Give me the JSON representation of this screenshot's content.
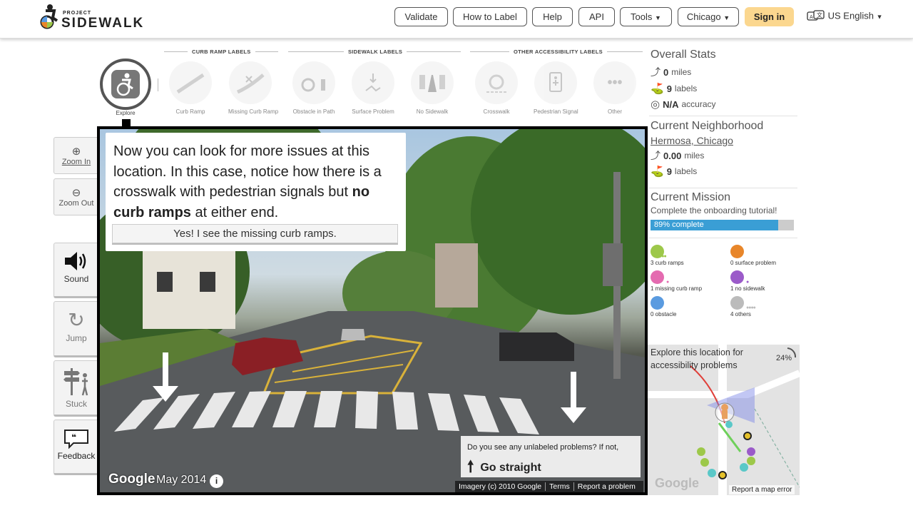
{
  "nav": {
    "logo_small": "PROJECT",
    "logo_big": "SIDEWALK",
    "buttons": [
      "Validate",
      "How to Label",
      "Help",
      "API",
      "Tools",
      "Chicago"
    ],
    "signin": "Sign in",
    "language": "US English"
  },
  "toolbar": {
    "groups": [
      "CURB RAMP LABELS",
      "SIDEWALK LABELS",
      "OTHER ACCESSIBILITY LABELS"
    ],
    "explore": "Explore",
    "labels": [
      "Curb Ramp",
      "Missing Curb Ramp",
      "Obstacle in Path",
      "Surface Problem",
      "No Sidewalk",
      "Crosswalk",
      "Pedestrian Signal",
      "Other"
    ]
  },
  "tools": {
    "zoom_in": "Zoom In",
    "zoom_out": "Zoom Out",
    "sound": "Sound",
    "jump": "Jump",
    "stuck": "Stuck",
    "feedback": "Feedback"
  },
  "tip": {
    "text_part1": "Now you can look for more issues at this location. In this case, notice how there is a crosswalk with pedestrian signals but ",
    "text_bold": "no curb ramps",
    "text_part2": " at either end.",
    "button": "Yes! I see the missing curb ramps."
  },
  "pano": {
    "question": "Do you see any unlabeled problems? If not,",
    "action": "Go straight",
    "google": "Google",
    "date": "May 2014",
    "info": "i",
    "footer": [
      "Imagery (c) 2010 Google",
      "Terms",
      "Report a problem"
    ]
  },
  "stats": {
    "overall_title": "Overall Stats",
    "miles_value": "0",
    "miles_unit": "miles",
    "labels_value": "9",
    "labels_unit": "labels",
    "accuracy_value": "N/A",
    "accuracy_unit": "accuracy",
    "neighborhood_title": "Current Neighborhood",
    "neighborhood_name": "Hermosa, Chicago",
    "n_miles_value": "0.00",
    "n_miles_unit": "miles",
    "n_labels_value": "9",
    "n_labels_unit": "labels",
    "mission_title": "Current Mission",
    "mission_desc": "Complete the onboarding tutorial!",
    "progress_text": "89% complete",
    "progress": 0.89
  },
  "counts": [
    {
      "text": "3 curb ramps",
      "color": "#9dc84a"
    },
    {
      "text": "0 surface problem",
      "color": "#e8862a"
    },
    {
      "text": "1 missing curb ramp",
      "color": "#e46bb0"
    },
    {
      "text": "1 no sidewalk",
      "color": "#9b5bc9"
    },
    {
      "text": "0 obstacle",
      "color": "#5a9be0"
    },
    {
      "text": "4 others",
      "color": "#bbbbbb"
    }
  ],
  "minimap": {
    "text": "Explore this location for accessibility problems",
    "pct": "24%",
    "google": "Google",
    "report": "Report a map error"
  }
}
